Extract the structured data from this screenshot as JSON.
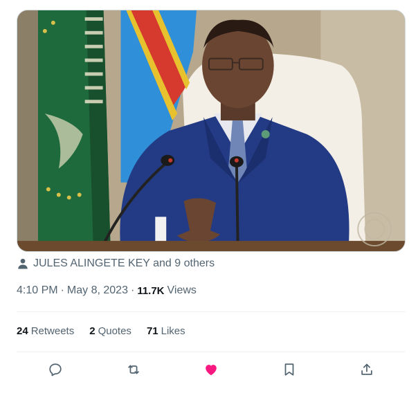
{
  "tweet": {
    "tagged_text": "JULES ALINGETE KEY and 9 others",
    "time": "4:10 PM",
    "separator": "·",
    "date": "May 8, 2023",
    "views_count": "11.7K",
    "views_label": "Views"
  },
  "stats": [
    {
      "count": "24",
      "label": "Retweets"
    },
    {
      "count": "2",
      "label": "Quotes"
    },
    {
      "count": "71",
      "label": "Likes"
    }
  ],
  "actions": [
    {
      "name": "reply-icon"
    },
    {
      "name": "retweet-icon"
    },
    {
      "name": "like-icon",
      "liked": true,
      "color": "#f91880"
    },
    {
      "name": "bookmark-icon"
    },
    {
      "name": "share-icon"
    }
  ],
  "colors": {
    "text_primary": "#0f1419",
    "text_secondary": "#536471",
    "action_icon": "#536471",
    "like_active": "#f91880",
    "divider": "#eff3f4"
  }
}
